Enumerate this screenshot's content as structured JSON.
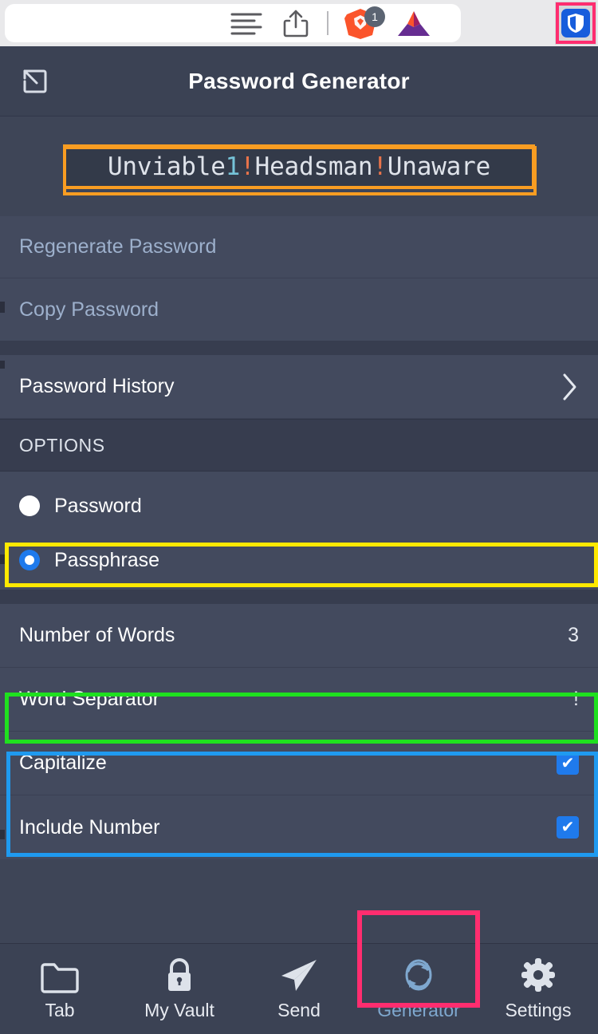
{
  "browser": {
    "icons": {
      "reader": "reader-mode-icon",
      "share": "share-icon",
      "brave": "brave-lion-icon",
      "brave_badge": "1",
      "bat": "bat-token-icon",
      "bitwarden": "bitwarden-shield-icon"
    }
  },
  "popup": {
    "header": {
      "title": "Password Generator",
      "popout_icon": "pop-out-icon"
    },
    "password": {
      "prefix": "Unviable",
      "number": "1",
      "sep1": "!",
      "word2": "Headsman",
      "sep2": "!",
      "word3": "Unaware",
      "full": "Unviable1!Headsman!Unaware"
    },
    "actions": [
      {
        "label": "Regenerate Password"
      },
      {
        "label": "Copy Password"
      }
    ],
    "history": {
      "label": "Password History",
      "chevron": "chevron-right-icon"
    },
    "options_header": "OPTIONS",
    "type_options": [
      {
        "label": "Password",
        "checked": false
      },
      {
        "label": "Passphrase",
        "checked": true
      }
    ],
    "settings": [
      {
        "label": "Number of Words",
        "value": "3",
        "kind": "value"
      },
      {
        "label": "Word Separator",
        "value": "!",
        "kind": "value"
      },
      {
        "label": "Capitalize",
        "value": "✔",
        "kind": "check"
      },
      {
        "label": "Include Number",
        "value": "✔",
        "kind": "check"
      }
    ],
    "tabs": [
      {
        "label": "Tab",
        "icon": "folder-icon",
        "active": false
      },
      {
        "label": "My Vault",
        "icon": "lock-icon",
        "active": false
      },
      {
        "label": "Send",
        "icon": "paper-plane-icon",
        "active": false
      },
      {
        "label": "Generator",
        "icon": "refresh-icon",
        "active": true
      },
      {
        "label": "Settings",
        "icon": "gear-icon",
        "active": false
      }
    ]
  },
  "colors": {
    "bg": "#3e4557",
    "row": "#434a5e",
    "accent_blue": "#1f7aec",
    "link": "#9db0cc",
    "orange_highlight": "#f99d22",
    "yellow_highlight": "#ffe900",
    "green_highlight": "#1fe01f",
    "blue_highlight": "#1f9af0",
    "pink_highlight": "#ff2d6f"
  }
}
